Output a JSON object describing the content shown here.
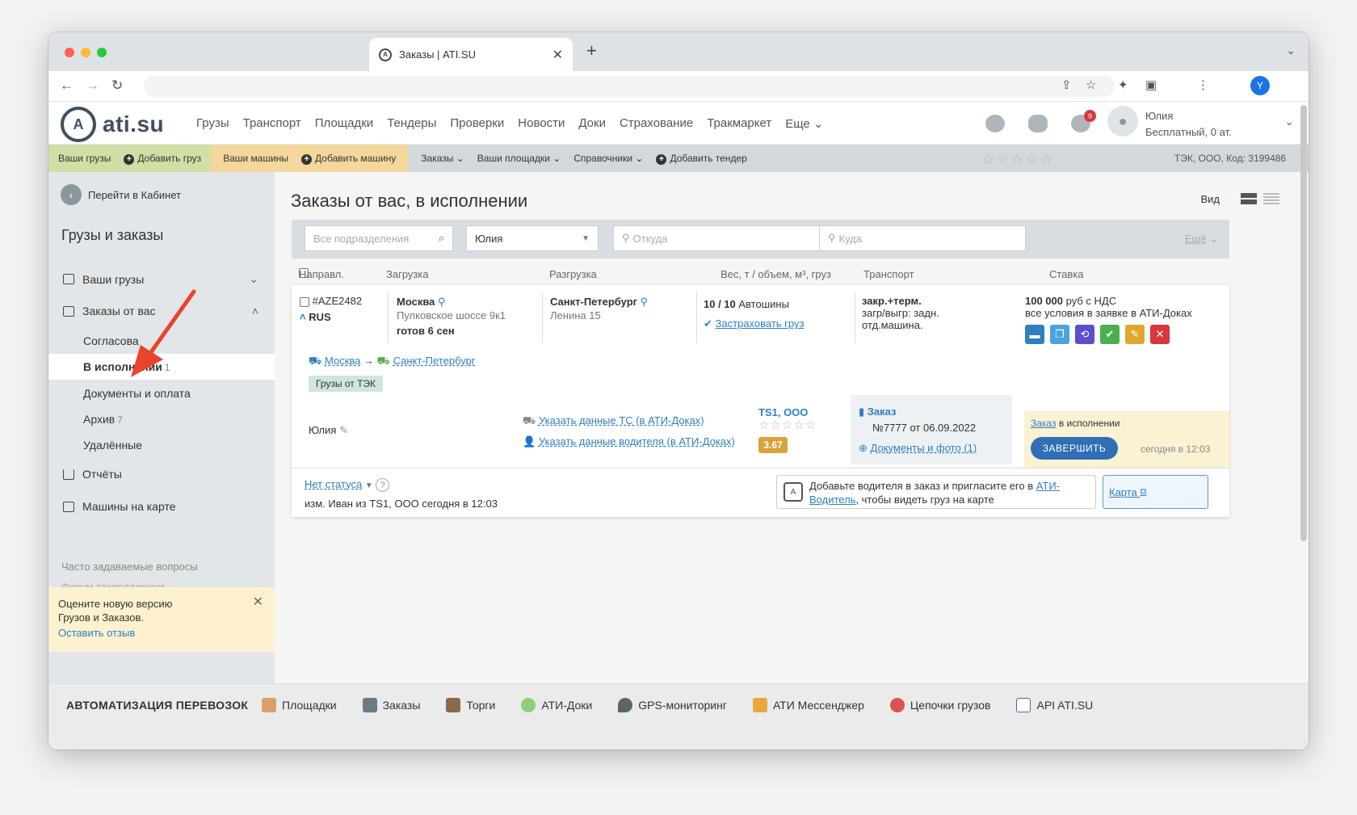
{
  "browser": {
    "tab_title": "Заказы | ATI.SU",
    "avatar_letter": "Y"
  },
  "header": {
    "logo": "ati.su",
    "nav": [
      "Грузы",
      "Транспорт",
      "Площадки",
      "Тендеры",
      "Проверки",
      "Новости",
      "Доки",
      "Страхование",
      "Тракмаркет",
      "Еще"
    ],
    "notif_count": "9",
    "user_name": "Юлия",
    "user_plan": "Бесплатный,  0 ат."
  },
  "subbar": {
    "your_cargo": "Ваши грузы",
    "add_cargo": "Добавить груз",
    "your_trucks": "Ваши машины",
    "add_truck": "Добавить машину",
    "orders": "Заказы",
    "your_sites": "Ваши площадки",
    "references": "Справочники",
    "add_tender": "Добавить тендер",
    "stars": "☆☆☆☆☆",
    "firm": "ТЭК, ООО,  Код: 3199486"
  },
  "sidebar": {
    "back": "Перейти в Кабинет",
    "title": "Грузы и заказы",
    "your_cargo": "Ваши грузы",
    "orders_from_you": "Заказы от вас",
    "sub": {
      "approval": "Согласова",
      "in_progress": "В исполнении",
      "in_progress_count": "1",
      "docs": "Документы и оплата",
      "archive": "Архив",
      "archive_count": "7",
      "deleted": "Удалённые"
    },
    "reports": "Отчёты",
    "map": "Машины на карте",
    "faq": "Часто задаваемые вопросы",
    "forum": "Форум техподдержки",
    "feedback_text": "Оцените новую версию Грузов и Заказов.",
    "feedback_link": "Оставить отзыв"
  },
  "main": {
    "title": "Заказы от вас, в исполнении",
    "view_label": "Вид",
    "filters": {
      "division": "Все подразделения",
      "user": "Юлия",
      "from": "Откуда",
      "to": "Куда",
      "more": "Ещё"
    },
    "columns": [
      "Направл.",
      "Загрузка",
      "Разгрузка",
      "Вес, т / объем, м³, груз",
      "Транспорт",
      "Ставка"
    ]
  },
  "order": {
    "id": "#AZE2482",
    "country": "RUS",
    "load_city": "Москва",
    "load_addr": "Пулковское шоссе 9к1",
    "load_ready": "готов 6 сен",
    "unload_city": "Санкт-Петербург",
    "unload_addr": "Ленина 15",
    "weight": "10 / 10",
    "cargo": "Автошины",
    "insure": "Застраховать груз",
    "transport1": "закр.+терм.",
    "transport2": "загр/выгр: задн.",
    "transport3": "отд.машина.",
    "rate": "100 000",
    "rate_unit": "руб с НДС",
    "rate_note": "все условия в заявке в АТИ-Доках",
    "route_from": "Москва",
    "route_arrow": "→",
    "route_to": "Санкт-Петербург",
    "tag": "Грузы от ТЭК",
    "person": "Юлия",
    "ts_link": "Указать данные ТС (в АТИ-Доках)",
    "driver_link": "Указать данные водителя (в АТИ-Доках)",
    "carrier": "TS1, ООО",
    "carrier_stars": "☆☆☆☆☆",
    "rating": "3.67",
    "doc_title": "Заказ",
    "doc_number": "№7777 от 06.09.2022",
    "doc_files": "Документы и фото (1)",
    "status_link": "Заказ",
    "status_text": "в исполнении",
    "finish_btn": "ЗАВЕРШИТЬ",
    "status_time": "сегодня в 12:03",
    "no_status": "Нет статуса",
    "changed": "изм. Иван из TS1, ООО сегодня в 12:03",
    "driver_hint_pre": "Добавьте водителя в заказ и пригласите его в ",
    "driver_hint_link": "АТИ-Водитель",
    "driver_hint_post": ", чтобы видеть груз на карте",
    "map_link": "Карта"
  },
  "footer": {
    "title": "АВТОМАТИЗАЦИЯ ПЕРЕВОЗОК",
    "links": [
      "Площадки",
      "Заказы",
      "Торги",
      "АТИ-Доки",
      "GPS-мониторинг",
      "АТИ Мессенджер",
      "Цепочки грузов",
      "API ATI.SU"
    ]
  },
  "colors": {
    "accent": "#2f7fbf",
    "green_bar": "#cfe0a6",
    "yellow_bar": "#f4d79a",
    "arrow": "#e8432d"
  }
}
